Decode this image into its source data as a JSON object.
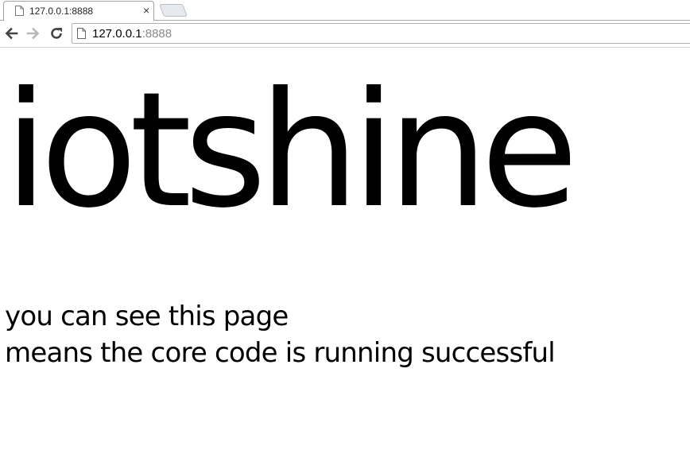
{
  "browser": {
    "tab": {
      "title": "127.0.0.1:8888",
      "close_glyph": "×"
    },
    "address_bar": {
      "host": "127.0.0.1",
      "rest": ":8888"
    },
    "icons": {
      "favicon": "page-icon",
      "back": "arrow-left-icon",
      "forward": "arrow-right-icon",
      "reload": "reload-icon",
      "omnibox": "page-icon"
    }
  },
  "page": {
    "headline": "iotshine",
    "lines": [
      "you can see this page",
      "means the core code is running successful"
    ]
  }
}
